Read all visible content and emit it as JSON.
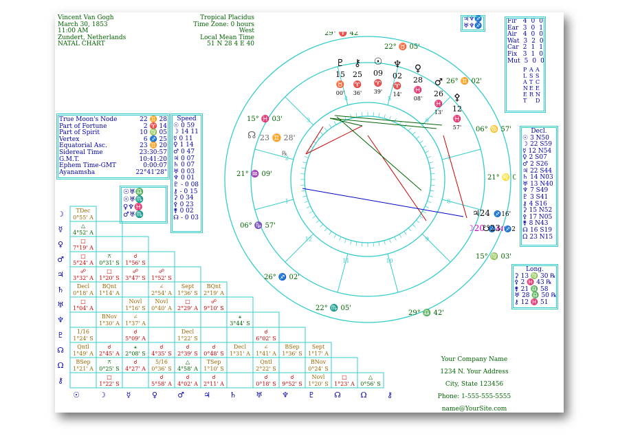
{
  "header": {
    "name": "Vincent Van Gogh",
    "date": "March 30, 1853",
    "time": "11:00 AM",
    "place": "Zundert, Netherlands",
    "chart_kind": "NATAL CHART",
    "zodiac": "Tropical Placidus",
    "timezone": "Time Zone: 0 hours West",
    "mean_time": "Local Mean Time",
    "coords": "51 N 28    4 E 40"
  },
  "points": [
    {
      "label": "True Moon's Node",
      "value": "22 ♊ 28"
    },
    {
      "label": "Part of Fortune",
      "value": "2 ♈ 14"
    },
    {
      "label": "Part of Spirit",
      "value": "10 ♍ 05"
    },
    {
      "label": "Vertex",
      "value": "6 ♐ 25"
    },
    {
      "label": "Equatorial Asc.",
      "value": "23 ♊ 20"
    },
    {
      "label": "Sidereal Time",
      "value": "23:30:57"
    },
    {
      "label": "G.M.T.",
      "value": "10:41:20"
    },
    {
      "label": "Ephem Time-GMT",
      "value": "0:00:07"
    },
    {
      "label": "Ayanamsha",
      "value": "22°41'28\""
    }
  ],
  "speed": {
    "title": "Speed",
    "rows": [
      {
        "glyph": "☉",
        "value": "0 59"
      },
      {
        "glyph": "☽",
        "value": "14 11"
      },
      {
        "glyph": "☿",
        "value": "0 11"
      },
      {
        "glyph": "♀",
        "value": "1 14"
      },
      {
        "glyph": "♂",
        "value": "0 47"
      },
      {
        "glyph": "♃",
        "value": "0 07"
      },
      {
        "glyph": "♄",
        "value": "0 07"
      },
      {
        "glyph": "♅",
        "value": "0 03"
      },
      {
        "glyph": "♆",
        "value": "0 01"
      },
      {
        "glyph": "♇",
        "value": "- 0 08"
      },
      {
        "glyph": "⚷",
        "value": "- 0 15"
      },
      {
        "glyph": "⚳",
        "value": "0 34"
      },
      {
        "glyph": "⚴",
        "value": "0 23"
      },
      {
        "glyph": "⚵",
        "value": "0 02"
      },
      {
        "glyph": "☊",
        "value": "- 0 03"
      }
    ]
  },
  "glyph_mini": [
    "☉♅♎",
    "☉♅♏",
    "♀♆♓",
    "♂♅♏"
  ],
  "top_right_mini": [
    "♃♆♐",
    "♅♆♐"
  ],
  "elements": {
    "rows": [
      {
        "label": "Fir",
        "a": "4",
        "b": "0",
        "c": "0"
      },
      {
        "label": "Ear",
        "a": "3",
        "b": "0",
        "c": "1"
      },
      {
        "label": "Air",
        "a": "4",
        "b": "0",
        "c": "0"
      },
      {
        "label": "Wat",
        "a": "3",
        "b": "2",
        "c": "0"
      },
      {
        "label": "Car",
        "a": "2",
        "b": "1",
        "c": "1"
      },
      {
        "label": "Fix",
        "a": "3",
        "b": "1",
        "c": "0"
      },
      {
        "label": "Mut",
        "a": "5",
        "b": "0",
        "c": "0"
      }
    ],
    "col_a": "PLANET",
    "col_b": "ASTER",
    "col_c": "ASCEND"
  },
  "declinations": {
    "title": "Decl.",
    "rows": [
      {
        "glyph": "☉",
        "value": "3 N50"
      },
      {
        "glyph": "☽",
        "value": "22 S59"
      },
      {
        "glyph": "☿",
        "value": "12 N54"
      },
      {
        "glyph": "♀",
        "value": "2 S07"
      },
      {
        "glyph": "♂",
        "value": "2 S26"
      },
      {
        "glyph": "♃",
        "value": "22 S44"
      },
      {
        "glyph": "♄",
        "value": "14 N03"
      },
      {
        "glyph": "♅",
        "value": "13 N40"
      },
      {
        "glyph": "♆",
        "value": "7 S49"
      },
      {
        "glyph": "♇",
        "value": "3 S41"
      },
      {
        "glyph": "⚷",
        "value": "4 S16"
      },
      {
        "glyph": "⚳",
        "value": "15 N52"
      },
      {
        "glyph": "⚴",
        "value": "17 N05"
      },
      {
        "glyph": "⚵",
        "value": "8 N43"
      },
      {
        "glyph": "☊",
        "value": "16 S19"
      },
      {
        "glyph": "Ω",
        "value": "23 N15"
      }
    ]
  },
  "longitudes": {
    "title": "Long.",
    "rows": [
      {
        "glyph": "⚳",
        "value": "13 ♍ 30 ℞"
      },
      {
        "glyph": "⚴",
        "value": "2 ♓ 43 ℞"
      },
      {
        "glyph": "⚵",
        "value": "21 ♎ 58"
      },
      {
        "glyph": "♅",
        "value": "28 ♎ 50 ℞"
      },
      {
        "glyph": "⚷",
        "value": "12 ♓ 51"
      }
    ]
  },
  "company": [
    "Your Company Name",
    "1234 N. Your Address",
    "City, State 123456",
    "Phone: 1-555-555-5555",
    "name@YourSite.com"
  ],
  "wheel": {
    "cusps": [
      {
        "deg": "29°",
        "sign": "♈",
        "min": "42'"
      },
      {
        "deg": "22°",
        "sign": "♉",
        "min": "05'"
      },
      {
        "deg": "26°",
        "sign": "♊",
        "min": "02'"
      },
      {
        "deg": "06°",
        "sign": "♋",
        "min": "57'"
      },
      {
        "deg": "21°",
        "sign": "♌",
        "min": "09'"
      },
      {
        "deg": "15°",
        "sign": "♍",
        "min": "03'"
      },
      {
        "deg": "29°",
        "sign": "♎",
        "min": "42'"
      },
      {
        "deg": "22°",
        "sign": "♏",
        "min": "05'"
      },
      {
        "deg": "26°",
        "sign": "♐",
        "min": "02'"
      },
      {
        "deg": "06°",
        "sign": "♑",
        "min": "57'"
      },
      {
        "deg": "21°",
        "sign": "♒",
        "min": "09'"
      },
      {
        "deg": "15°",
        "sign": "♓",
        "min": "03'"
      }
    ],
    "house_numbers": [
      "1",
      "2",
      "3",
      "4",
      "5",
      "6",
      "7",
      "8",
      "9",
      "10",
      "11",
      "12"
    ],
    "planets_top": [
      {
        "glyph": "♇",
        "deg": "15",
        "sign": "♉",
        "min": "00'"
      },
      {
        "glyph": "⚷",
        "deg": "25",
        "sign": "♈",
        "min": "36'"
      },
      {
        "glyph": "☉",
        "deg": "09",
        "sign": "♈",
        "min": "39'"
      },
      {
        "glyph": "♆",
        "deg": "02",
        "sign": "♈",
        "min": "14'"
      },
      {
        "glyph": "♀",
        "deg": "28",
        "sign": "♓",
        "min": "08'"
      },
      {
        "glyph": "♂",
        "deg": "26",
        "sign": "♓",
        "min": "13'"
      },
      {
        "glyph": "⚴",
        "deg": "12",
        "sign": "♓",
        "min": "57'"
      }
    ],
    "planets_right": [
      {
        "glyph": "♃",
        "deg": "24",
        "sign": "♐",
        "min": "16'"
      },
      {
        "glyph": "☽",
        "deg": "20",
        "sign": "♐",
        "min": "44'"
      },
      {
        "glyph": "☋",
        "deg": "23",
        "sign": "♐",
        "min": "28'"
      }
    ],
    "node_left": {
      "glyph": "☊",
      "deg": "23",
      "sign": "♊",
      "min": "28'"
    },
    "retro": "℞"
  },
  "aspect_grid": {
    "row_glyphs": [
      "☽",
      "☿",
      "♀",
      "♂",
      "♃",
      "♄",
      "♅",
      "♆",
      "♇",
      "☊",
      "Ω",
      "⚷",
      "♅"
    ],
    "col_glyphs": [
      "☉",
      "☽",
      "☿",
      "♀",
      "♂",
      "♃",
      "♄",
      "♅",
      "♆",
      "♇",
      "☊",
      "Ω",
      "⚷"
    ],
    "cells": [
      [
        "TDec 0°55' A"
      ],
      [
        "△ 4°52' A"
      ],
      [
        "□ 7°19' A"
      ],
      [
        "□ 5°24' A",
        "⚻ 0°31' S",
        "☌ 1°56' S"
      ],
      [
        "☍ 3°32' A",
        "□ 1°20' S",
        "☍ 3°47' S",
        "☍ 1°52' S"
      ],
      [
        "Decl 0°18' A",
        "BQnt 1°14' A",
        "",
        "∠ 2°54' A",
        "Sept 1°36' S",
        "BQnt 2°19' A"
      ],
      [
        "□ 1°04' A",
        "",
        "Novl 1°16' S",
        "Novl 0°40' A",
        "□ 2°29' A",
        "☍ 9°10' S"
      ],
      [
        "",
        "BNov 1°30' A",
        "∠ 1°37' A",
        "",
        "",
        "",
        "⚹ 3°44' S"
      ],
      [
        "1/16 1°24' S",
        "",
        "☌ 5°09' A",
        "",
        "Decl 1°22' S",
        "",
        "",
        "☌ 6°02' S"
      ],
      [
        "Qntl 1°49' A",
        "☌ 2°45' A",
        "⚹ 2°08' S",
        "☌ 4°35' S",
        "☌ 2°39' S",
        "☌ 0°48' S",
        "Decl 1°31' A",
        "∠ 1°41' A",
        "BSep 1°36' S",
        "Sept 1°17' A"
      ],
      [
        "BSep 1°21' A",
        "⚻ 0°25' S",
        "☌ 4°27' A",
        "5/16 0°36' S",
        "△ 4°58' A",
        "TSep 1°10' S",
        "",
        "Qntl 2°22' S",
        "",
        "BNov 0°24' S"
      ],
      [
        "",
        "□ 1°22' S",
        "",
        "☌ 5°58' A",
        "☌ 4°02' A",
        "☌ 2°11' A",
        "",
        "☌ 0°18' S",
        "☌ 9°52' S",
        "Novl 1°20' S",
        "□ 1°23' A",
        "△ 0°56' S"
      ]
    ]
  },
  "colors": {
    "frame": "#33cccc",
    "text": "#006400",
    "red": "#cc0000",
    "blue": "#0000cc",
    "magenta": "#cc00cc"
  }
}
